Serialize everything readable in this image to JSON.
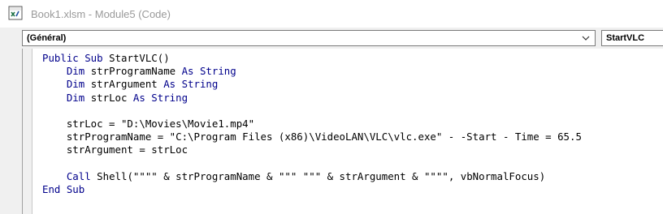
{
  "window": {
    "title": "Book1.xlsm - Module5 (Code)",
    "icon": "excel-vba-icon"
  },
  "toolbar": {
    "object_dropdown": "(Général)",
    "procedure_dropdown": "StartVLC"
  },
  "colors": {
    "keyword": "#00008b",
    "text": "#000000"
  },
  "code": {
    "lines": [
      [
        {
          "t": "Public Sub",
          "k": true
        },
        {
          "t": " StartVLC()"
        }
      ],
      [
        {
          "t": "    "
        },
        {
          "t": "Dim",
          "k": true
        },
        {
          "t": " strProgramName "
        },
        {
          "t": "As String",
          "k": true
        }
      ],
      [
        {
          "t": "    "
        },
        {
          "t": "Dim",
          "k": true
        },
        {
          "t": " strArgument "
        },
        {
          "t": "As String",
          "k": true
        }
      ],
      [
        {
          "t": "    "
        },
        {
          "t": "Dim",
          "k": true
        },
        {
          "t": " strLoc "
        },
        {
          "t": "As String",
          "k": true
        }
      ],
      [],
      [
        {
          "t": "    strLoc = \"D:\\Movies\\Movie1.mp4\""
        }
      ],
      [
        {
          "t": "    strProgramName = \"C:\\Program Files (x86)\\VideoLAN\\VLC\\vlc.exe\" - -Start - Time = 65.5"
        }
      ],
      [
        {
          "t": "    strArgument = strLoc"
        }
      ],
      [],
      [
        {
          "t": "    "
        },
        {
          "t": "Call",
          "k": true
        },
        {
          "t": " Shell(\"\"\"\" & strProgramName & \"\"\" \"\"\" & strArgument & \"\"\"\", vbNormalFocus)"
        }
      ],
      [
        {
          "t": "End Sub",
          "k": true
        }
      ]
    ]
  }
}
